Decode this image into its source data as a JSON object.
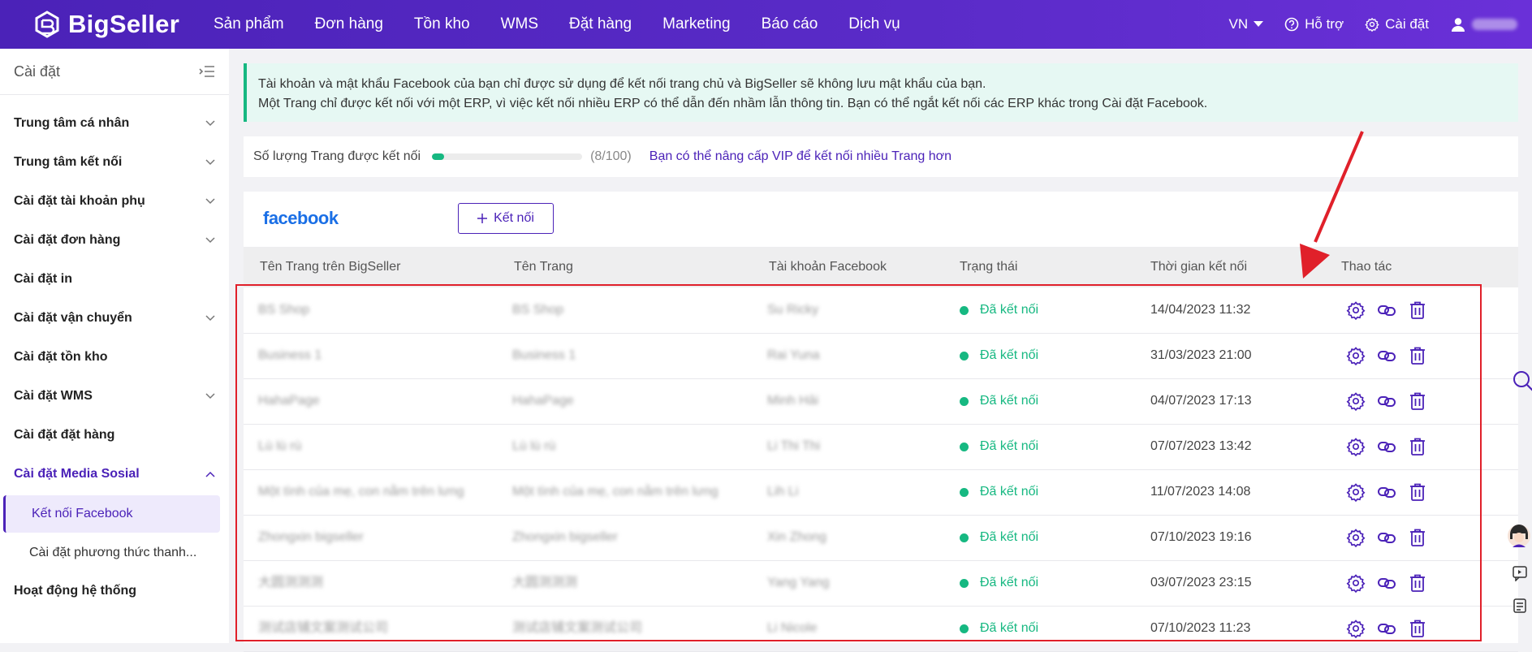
{
  "header": {
    "brand": "BigSeller",
    "nav": [
      "Sản phẩm",
      "Đơn hàng",
      "Tồn kho",
      "WMS",
      "Đặt hàng",
      "Marketing",
      "Báo cáo",
      "Dịch vụ"
    ],
    "language": "VN",
    "support": "Hỗ trợ",
    "settings": "Cài đặt"
  },
  "sidebar": {
    "title": "Cài đặt",
    "items": [
      {
        "label": "Trung tâm cá nhân",
        "expandable": true
      },
      {
        "label": "Trung tâm kết nối",
        "expandable": true
      },
      {
        "label": "Cài đặt tài khoản phụ",
        "expandable": true
      },
      {
        "label": "Cài đặt đơn hàng",
        "expandable": true
      },
      {
        "label": "Cài đặt in",
        "expandable": false
      },
      {
        "label": "Cài đặt vận chuyển",
        "expandable": true
      },
      {
        "label": "Cài đặt tồn kho",
        "expandable": false
      },
      {
        "label": "Cài đặt WMS",
        "expandable": true
      },
      {
        "label": "Cài đặt đặt hàng",
        "expandable": false
      },
      {
        "label": "Cài đặt Media Sosial",
        "expandable": true,
        "expanded": true
      },
      {
        "label": "Hoạt động hệ thống",
        "expandable": false
      }
    ],
    "subitems": [
      {
        "label": "Kết nối Facebook",
        "active": true
      },
      {
        "label": "Cài đặt phương thức thanh..."
      }
    ]
  },
  "notice": {
    "line1": "Tài khoản và mật khẩu Facebook của bạn chỉ được sử dụng để kết nối trang chủ và BigSeller sẽ không lưu mật khẩu của bạn.",
    "line2": "Một Trang chỉ được kết nối với một ERP, vì việc kết nối nhiều ERP có thể dẫn đến nhầm lẫn thông tin. Bạn có thể ngắt kết nối các ERP khác trong Cài đặt Facebook."
  },
  "quota": {
    "label": "Số lượng Trang được kết nối",
    "count": "(8/100)",
    "progress_fraction": 0.08,
    "upgrade_link": "Bạn có thể nâng cấp VIP để kết nối nhiều Trang hơn"
  },
  "panel": {
    "brand": "facebook",
    "connect_button": "Kết nối"
  },
  "table": {
    "columns": [
      "Tên Trang trên BigSeller",
      "Tên Trang",
      "Tài khoản Facebook",
      "Trạng thái",
      "Thời gian kết nối",
      "Thao tác"
    ],
    "rows": [
      {
        "bigseller_name": "BS Shop",
        "page_name": "BS Shop",
        "account": "Su Ricky",
        "status": "Đã kết nối",
        "time": "14/04/2023 11:32"
      },
      {
        "bigseller_name": "Business 1",
        "page_name": "Business 1",
        "account": "Rai Yuna",
        "status": "Đã kết nối",
        "time": "31/03/2023 21:00"
      },
      {
        "bigseller_name": "HahaPage",
        "page_name": "HahaPage",
        "account": "Minh Hải",
        "status": "Đã kết nối",
        "time": "04/07/2023 17:13"
      },
      {
        "bigseller_name": "Lù lù rù",
        "page_name": "Lù lù rù",
        "account": "Li Thi Thi",
        "status": "Đã kết nối",
        "time": "07/07/2023 13:42"
      },
      {
        "bigseller_name": "Một tình của mẹ, con nằm trên lưng",
        "page_name": "Một tình của mẹ, con nằm trên lưng",
        "account": "Lih Li",
        "status": "Đã kết nối",
        "time": "11/07/2023 14:08"
      },
      {
        "bigseller_name": "Zhongxin bigseller",
        "page_name": "Zhongxin bigseller",
        "account": "Xin Zhong",
        "status": "Đã kết nối",
        "time": "07/10/2023 19:16"
      },
      {
        "bigseller_name": "大圆测测测",
        "page_name": "大圆测测测",
        "account": "Yang Yang",
        "status": "Đã kết nối",
        "time": "03/07/2023 23:15"
      },
      {
        "bigseller_name": "测试店铺文案测试公司",
        "page_name": "测试店铺文案测试公司",
        "account": "Li Nicole",
        "status": "Đã kết nối",
        "time": "07/10/2023 11:23"
      }
    ]
  },
  "colors": {
    "brand": "#4b22b8",
    "success": "#16b881",
    "highlight": "#e0202a",
    "facebook": "#1a6fe6"
  },
  "icons": [
    "search-icon",
    "gear-icon",
    "link-icon",
    "trash-icon",
    "help-icon",
    "user-icon",
    "collapse-menu-icon",
    "chevron-down-icon",
    "chevron-up-icon",
    "plus-icon",
    "caret-down-icon",
    "chat-icon",
    "notes-icon"
  ]
}
